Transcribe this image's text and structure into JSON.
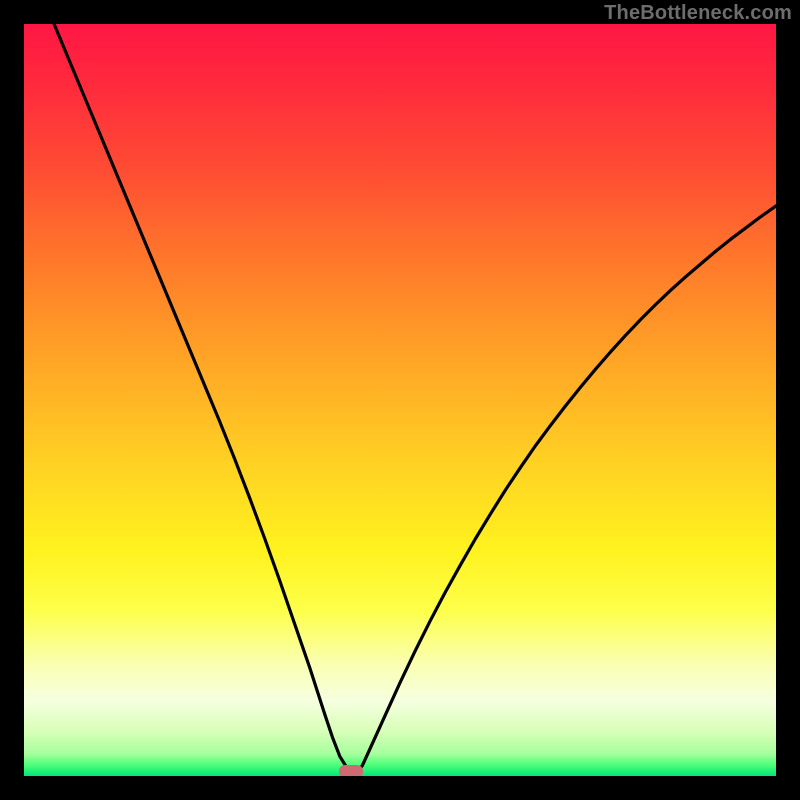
{
  "watermark": "TheBottleneck.com",
  "colors": {
    "frame": "#000000",
    "curve": "#000000",
    "marker": "#d06a72"
  },
  "chart_data": {
    "type": "line",
    "title": "",
    "xlabel": "",
    "ylabel": "",
    "xlim": [
      0,
      100
    ],
    "ylim": [
      0,
      100
    ],
    "grid": false,
    "legend": false,
    "marker": {
      "x": 43.5,
      "y": 0.7
    },
    "series": [
      {
        "name": "bottleneck-curve",
        "x": [
          4,
          6,
          8,
          10,
          12,
          14,
          16,
          18,
          20,
          22,
          24,
          26,
          28,
          30,
          32,
          34,
          36,
          38,
          40,
          41,
          42,
          43,
          43.5,
          44,
          45,
          46,
          48,
          50,
          52,
          54,
          56,
          58,
          60,
          62,
          64,
          66,
          68,
          70,
          72,
          74,
          76,
          78,
          80,
          82,
          84,
          86,
          88,
          90,
          92,
          94,
          96,
          98,
          100
        ],
        "y": [
          100,
          95.2,
          90.4,
          85.6,
          80.8,
          76.0,
          71.2,
          66.4,
          61.6,
          56.8,
          52.0,
          47.2,
          42.2,
          37.0,
          31.6,
          26.0,
          20.2,
          14.4,
          8.2,
          5.2,
          2.6,
          1.0,
          0.0,
          0.0,
          1.4,
          3.6,
          8.0,
          12.4,
          16.6,
          20.6,
          24.4,
          28.0,
          31.5,
          34.8,
          38.0,
          41.0,
          43.9,
          46.6,
          49.2,
          51.7,
          54.1,
          56.4,
          58.6,
          60.7,
          62.7,
          64.6,
          66.4,
          68.1,
          69.8,
          71.4,
          72.9,
          74.4,
          75.8
        ]
      }
    ]
  }
}
